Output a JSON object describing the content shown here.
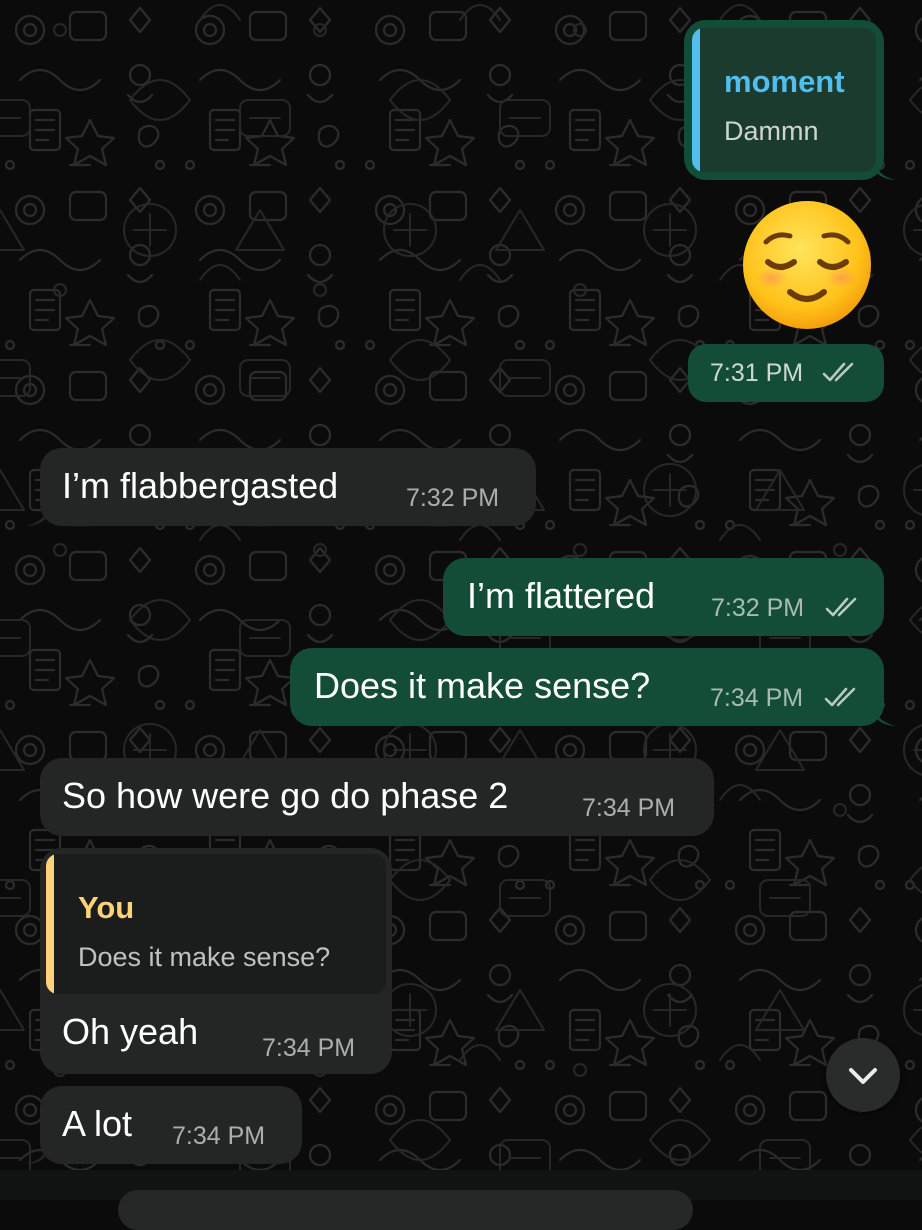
{
  "colors": {
    "background": "#0b0b0b",
    "outgoing_bubble": "#144d37",
    "incoming_bubble": "#242626",
    "quote_moment_accent": "#53bdeb",
    "quote_you_accent": "#ffd279",
    "read_ticks": "#ffffffaa"
  },
  "messages": [
    {
      "direction": "outgoing",
      "quote": {
        "name": "moment",
        "text": "Dammn"
      }
    },
    {
      "direction": "outgoing",
      "emoji": "relieved-face",
      "time": "7:31 PM",
      "status": "read"
    },
    {
      "direction": "incoming",
      "text": "I’m flabbergasted",
      "time": "7:32 PM"
    },
    {
      "direction": "outgoing",
      "text": "I’m flattered",
      "time": "7:32 PM",
      "status": "read"
    },
    {
      "direction": "outgoing",
      "text": "Does it make sense?",
      "time": "7:34 PM",
      "status": "read"
    },
    {
      "direction": "incoming",
      "text": "So how were go do phase 2",
      "time": "7:34 PM"
    },
    {
      "direction": "incoming",
      "quote": {
        "name": "You",
        "text": "Does it make sense?"
      },
      "text": "Oh yeah",
      "time": "7:34 PM"
    },
    {
      "direction": "incoming",
      "text": "A lot",
      "time": "7:34 PM"
    }
  ],
  "controls": {
    "scroll_down_icon": "chevron-down-icon"
  }
}
